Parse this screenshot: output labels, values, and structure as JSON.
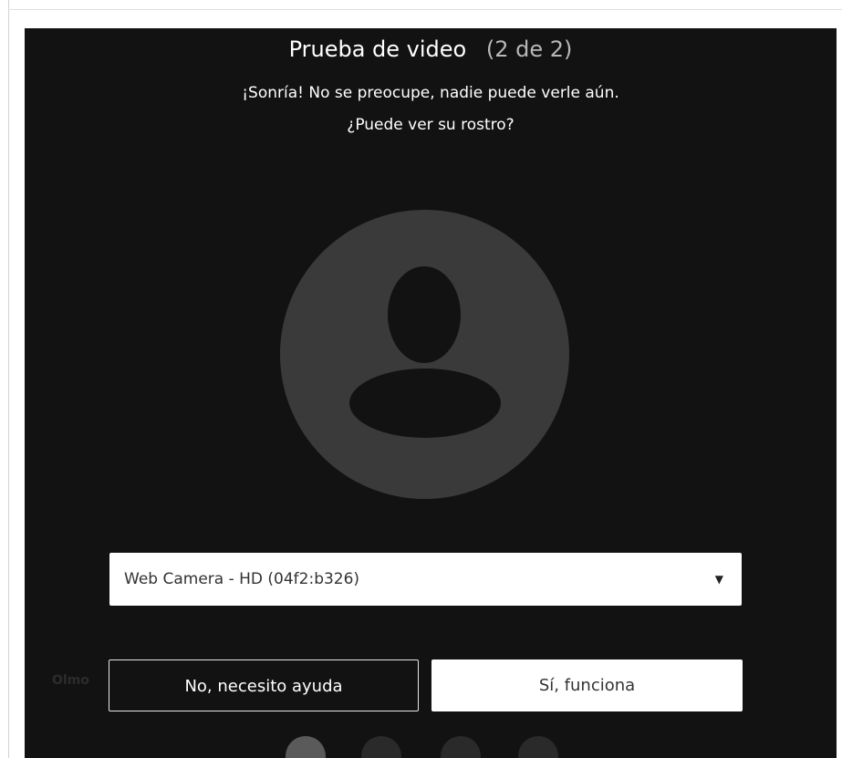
{
  "dialog": {
    "title": "Prueba de video",
    "step": "(2 de 2)",
    "subtitle_line1": "¡Sonría! No se preocupe, nadie puede verle aún.",
    "subtitle_line2": "¿Puede ver su rostro?"
  },
  "camera_select": {
    "value": "Web Camera - HD (04f2:b326)",
    "caret_icon": "dropdown-caret-icon"
  },
  "background": {
    "label": "Olmo"
  },
  "buttons": {
    "help_label": "No, necesito ayuda",
    "ok_label": "Sí, funciona"
  },
  "colors": {
    "stage_background": "#121212",
    "avatar_circle": "#3a3a3a",
    "button_light": "#ffffff"
  }
}
